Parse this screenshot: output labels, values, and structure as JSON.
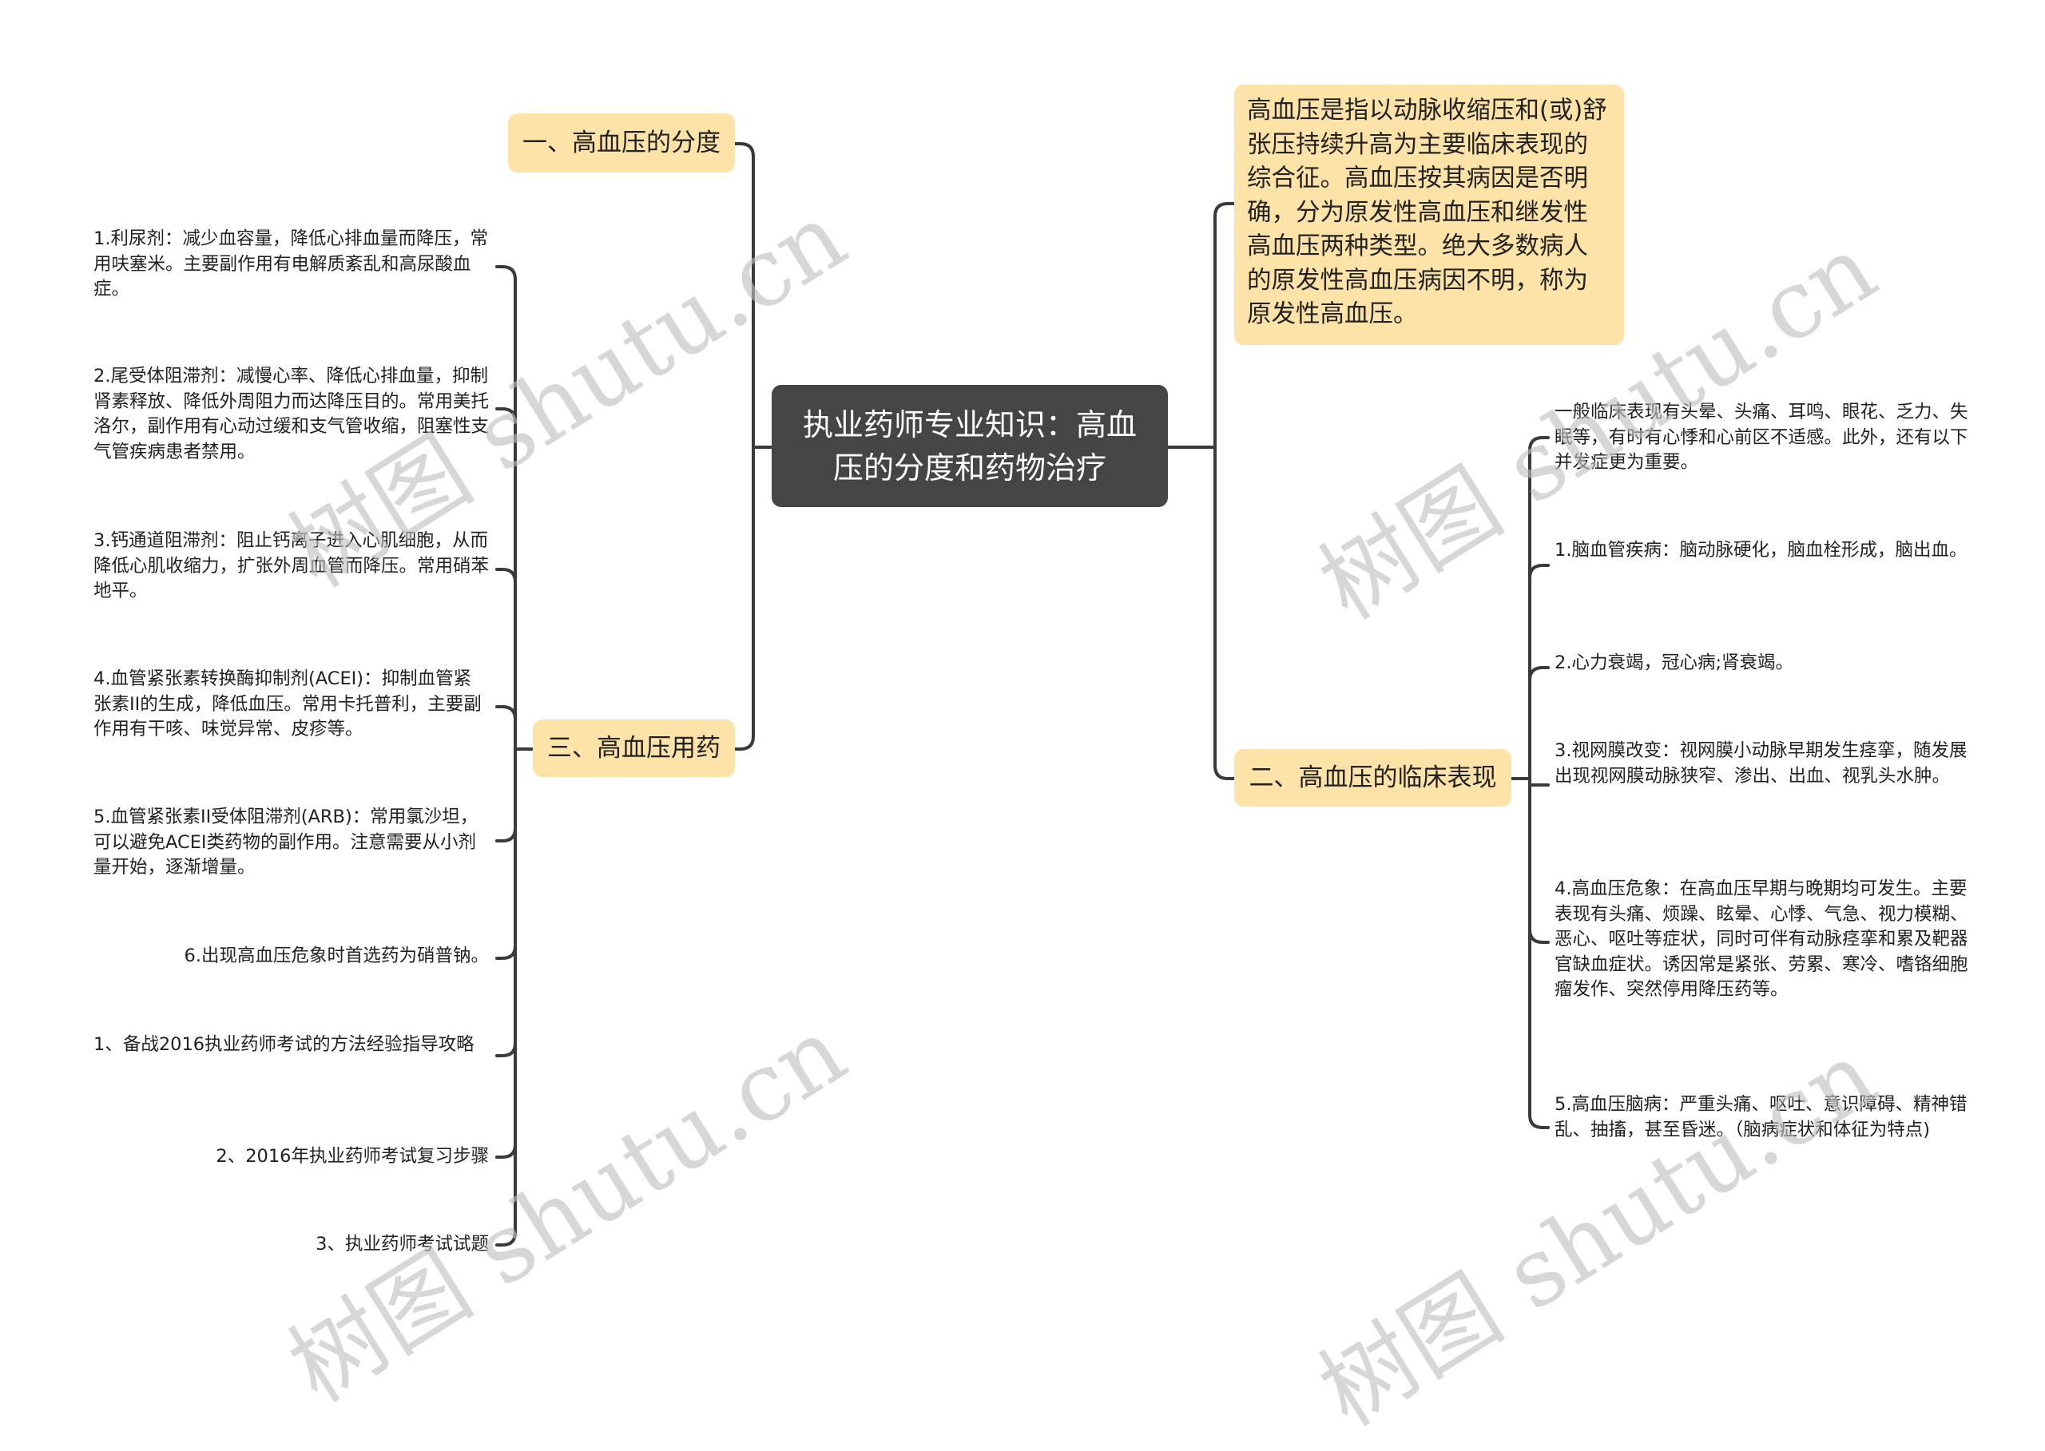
{
  "root": {
    "title": "执业药师专业知识：高血压的分度和药物治疗"
  },
  "definition": {
    "text": "高血压是指以动脉收缩压和(或)舒张压持续升高为主要临床表现的综合征。高血压按其病因是否明确，分为原发性高血压和继发性高血压两种类型。绝大多数病人的原发性高血压病因不明，称为原发性高血压。"
  },
  "branches": {
    "grading": {
      "label": "一、高血压的分度"
    },
    "clinical": {
      "label": "二、高血压的临床表现",
      "items": [
        "一般临床表现有头晕、头痛、耳鸣、眼花、乏力、失眠等，有时有心悸和心前区不适感。此外，还有以下并发症更为重要。",
        "1.脑血管疾病：脑动脉硬化，脑血栓形成，脑出血。",
        "2.心力衰竭，冠心病;肾衰竭。",
        "3.视网膜改变：视网膜小动脉早期发生痉挛，随发展出现视网膜动脉狭窄、渗出、出血、视乳头水肿。",
        "4.高血压危象：在高血压早期与晚期均可发生。主要表现有头痛、烦躁、眩晕、心悸、气急、视力模糊、恶心、呕吐等症状，同时可伴有动脉痉挛和累及靶器官缺血症状。诱因常是紧张、劳累、寒冷、嗜铬细胞瘤发作、突然停用降压药等。",
        "5.高血压脑病：严重头痛、呕吐、意识障碍、精神错乱、抽搐，甚至昏迷。（脑病症状和体征为特点)"
      ]
    },
    "drugs": {
      "label": "三、高血压用药",
      "items": [
        "1.利尿剂：减少血容量，降低心排血量而降压，常用呋塞米。主要副作用有电解质紊乱和高尿酸血症。",
        "2.尾受体阻滞剂：减慢心率、降低心排血量，抑制肾素释放、降低外周阻力而达降压目的。常用美托洛尔，副作用有心动过缓和支气管收缩，阻塞性支气管疾病患者禁用。",
        "3.钙通道阻滞剂：阻止钙离子进入心肌细胞，从而降低心肌收缩力，扩张外周血管而降压。常用硝苯地平。",
        "4.血管紧张素转换酶抑制剂(ACEI)：抑制血管紧张素II的生成，降低血压。常用卡托普利，主要副作用有干咳、味觉异常、皮疹等。",
        "5.血管紧张素II受体阻滞剂(ARB)：常用氯沙坦，可以避免ACEI类药物的副作用。注意需要从小剂量开始，逐渐增量。",
        "6.出现高血压危象时首选药为硝普钠。",
        "1、备战2016执业药师考试的方法经验指导攻略",
        "2、2016年执业药师考试复习步骤",
        "3、执业药师考试试题"
      ]
    }
  },
  "watermark": {
    "text": "树图 shutu.cn"
  },
  "colors": {
    "root_bg": "#454545",
    "topic_bg": "#fde3a7",
    "line": "#3a3a3a",
    "watermark": "#bebebe"
  }
}
